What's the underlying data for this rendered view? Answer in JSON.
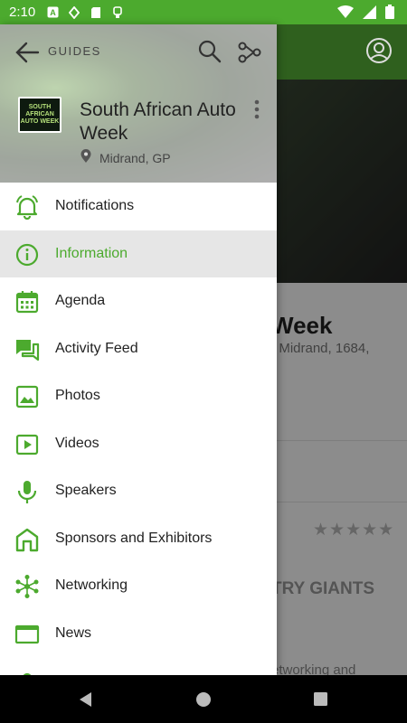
{
  "status_bar": {
    "time": "2:10"
  },
  "background": {
    "title_fragment": "Week",
    "address_fragment": ", Midrand, 1684,",
    "stars": "★★★★★",
    "caps_fragment": "TRY GIANTS",
    "tail_fragment": "etworking and"
  },
  "drawer": {
    "header": {
      "guides_label": "GUIDES",
      "event_title": "South African Auto Week",
      "location": "Midrand, GP",
      "logo_line1": "SOUTH AFRICAN",
      "logo_line2": "AUTO WEEK"
    },
    "menu": [
      {
        "label": "Notifications",
        "icon": "bell-icon",
        "active": false
      },
      {
        "label": "Information",
        "icon": "info-icon",
        "active": true
      },
      {
        "label": "Agenda",
        "icon": "calendar-icon",
        "active": false
      },
      {
        "label": "Activity Feed",
        "icon": "chat-icon",
        "active": false
      },
      {
        "label": "Photos",
        "icon": "photo-icon",
        "active": false
      },
      {
        "label": "Videos",
        "icon": "video-icon",
        "active": false
      },
      {
        "label": "Speakers",
        "icon": "microphone-icon",
        "active": false
      },
      {
        "label": "Sponsors and Exhibitors",
        "icon": "booth-icon",
        "active": false
      },
      {
        "label": "Networking",
        "icon": "network-icon",
        "active": false
      },
      {
        "label": "News",
        "icon": "news-icon",
        "active": false
      }
    ]
  },
  "colors": {
    "accent": "#4caa2e",
    "active_bg": "#e6e6e6"
  }
}
